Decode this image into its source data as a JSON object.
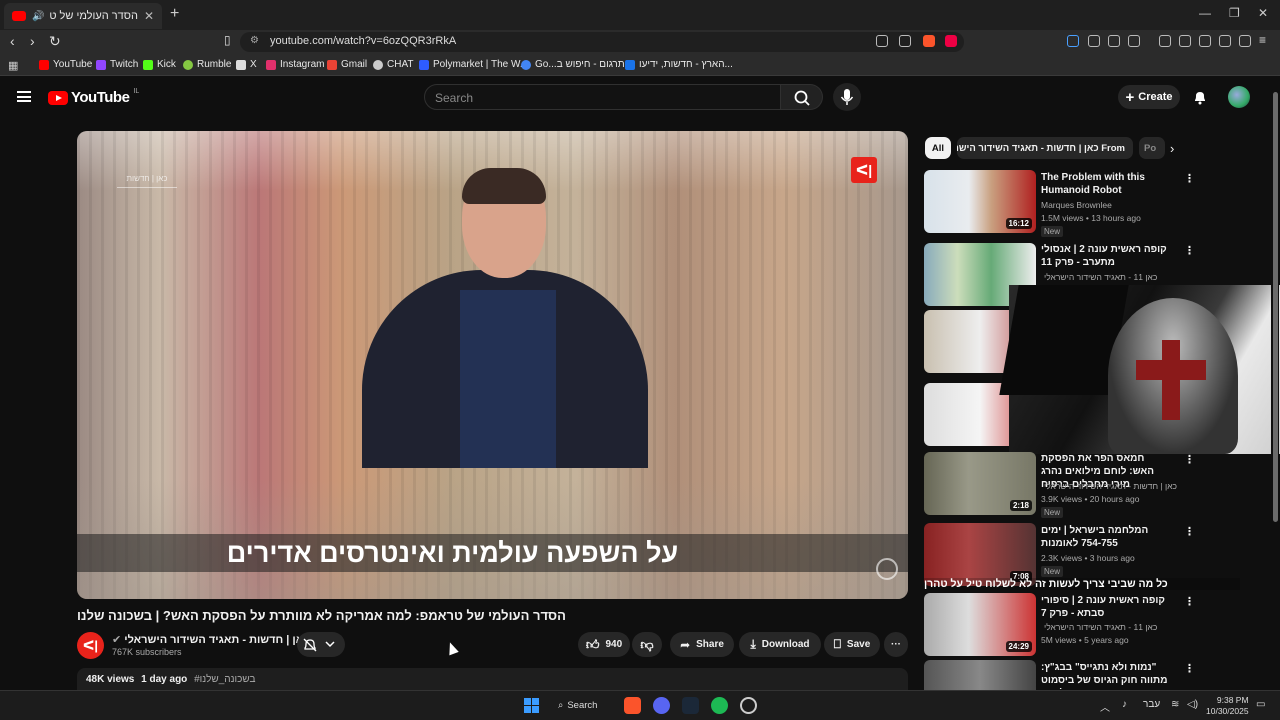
{
  "browser": {
    "tab_title": "הסדר העולמי של טראמפ: לתו...",
    "url": "youtube.com/watch?v=6ozQQR3rRkA",
    "bookmarks": [
      {
        "label": "YouTube",
        "color": "#ff0000"
      },
      {
        "label": "Twitch",
        "color": "#9146ff"
      },
      {
        "label": "Kick",
        "color": "#53fc18"
      },
      {
        "label": "Rumble",
        "color": "#85c742"
      },
      {
        "label": "X",
        "color": "#ffffff"
      },
      {
        "label": "Instagram",
        "color": "#e1306c"
      },
      {
        "label": "Gmail",
        "color": "#ea4335"
      },
      {
        "label": "CHAT",
        "color": "#cccccc"
      },
      {
        "label": "Polymarket | The W...",
        "color": "#2e5cff"
      },
      {
        "label": "Go...תרגום - חיפוש ב",
        "color": "#4285f4"
      },
      {
        "label": "הארץ - חדשות, ידיעו...",
        "color": "#1a73e8"
      }
    ]
  },
  "header": {
    "logo_text": "YouTube",
    "logo_country": "IL",
    "search_placeholder": "Search",
    "create_label": "Create"
  },
  "player": {
    "subtitle": "על השפעה עולמית ואינטרסים אדירים",
    "channel_watermark": "כאן | חדשות"
  },
  "video": {
    "title": "הסדר העולמי של טראמפ: למה אמריקה לא מוותרת על הפסקת האש? | בשכונה שלנו",
    "channel_name": "כאן | חדשות - תאגיד השידור הישראלי",
    "subscribers": "767K subscribers",
    "likes": "940",
    "share_label": "Share",
    "download_label": "Download",
    "save_label": "Save",
    "views": "48K views",
    "age": "1 day ago",
    "hashtag": "#בשכונה_שלנו"
  },
  "sidebar": {
    "chips": {
      "all": "All",
      "from": "From כאן | חדשות - תאגיד השידור הישראלי",
      "more": "Po"
    },
    "items": [
      {
        "title": "The Problem with this Humanoid Robot",
        "channel": "Marques Brownlee",
        "meta": "1.5M views • 13 hours ago",
        "badge": "New",
        "duration": "16:12"
      },
      {
        "title": "קופה ראשית עונה 2 | אנסולי מתערב - פרק 11",
        "channel": "כאן 11 - תאגיד השידור הישראלי",
        "meta": "",
        "badge": "",
        "duration": ""
      },
      {
        "title": "חמאס הפר את הפסקת האש: לוחם מילואים נהרג מירי מחבלים ברפיח",
        "channel": "כאן | חדשות - תאגיד השידור הישראלי",
        "meta": "3.9K views • 20 hours ago",
        "badge": "New",
        "duration": "2:18"
      },
      {
        "title": "המלחמה בישראל | ימים 754-755 לאומנות",
        "channel": "",
        "meta": "2.3K views • 3 hours ago",
        "badge": "New",
        "duration": "7:08"
      },
      {
        "title": "קופה ראשית עונה 2 | סיפורי סבתא - פרק 7",
        "channel": "כאן 11 - תאגיד השידור הישראלי",
        "meta": "5M views • 5 years ago",
        "badge": "",
        "duration": "24:29"
      },
      {
        "title": "\"נמות ולא נתגייס\" בבג\"ץ: מתווה חוק הגיוס של ביסמוט - והכעס בקואליציה",
        "channel": "",
        "meta": "",
        "badge": "",
        "duration": ""
      }
    ],
    "overlay_caption": "כל מה שביבי צריך לעשות זה לא לשלוח טיל על טהרן"
  },
  "taskbar": {
    "search_label": "Search",
    "lang": "עבר",
    "time": "9:38 PM",
    "date": "10/30/2025"
  }
}
